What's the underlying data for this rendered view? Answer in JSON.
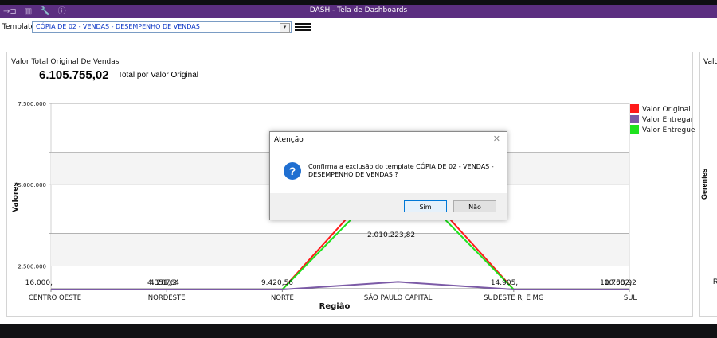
{
  "window": {
    "title": "DASH - Tela de Dashboards",
    "toolbar_icons": [
      "exit-icon",
      "grid-icon",
      "wrench-icon",
      "info-icon"
    ]
  },
  "template": {
    "label": "Template",
    "selected": "CÓPIA DE 02 - VENDAS - DESEMPENHO DE VENDAS"
  },
  "panel": {
    "title": "Valor Total Original De Vendas",
    "total_value": "6.105.755,02",
    "total_caption": "Total por Valor Original"
  },
  "panel2": {
    "title": "Valo",
    "axis_label": "Gerentes",
    "tick": "R"
  },
  "colors": {
    "titlebar": "#5b2e80",
    "valor_original": "#ff1a1a",
    "valor_entregar": "#7b5aa6",
    "valor_entregue": "#1ee21e"
  },
  "chart_data": {
    "type": "line",
    "xlabel": "Região",
    "ylabel": "Valores",
    "categories": [
      "CENTRO OESTE",
      "NORDESTE",
      "NORTE",
      "SÃO PAULO CAPITAL",
      "SUDESTE RJ E MG",
      "SUL"
    ],
    "y_ticks": [
      "2.500.000",
      "5.000.000",
      "7.500.000"
    ],
    "ylim": [
      1800000,
      7500000
    ],
    "grid": true,
    "legend_position": "top-right",
    "series": [
      {
        "name": "Valor Original",
        "values": [
          16000,
          4350,
          9100,
          5700000,
          14900,
          10700
        ]
      },
      {
        "name": "Valor Entregar",
        "values": [
          0,
          0,
          0,
          2010223.82,
          0,
          0
        ]
      },
      {
        "name": "Valor Entregue",
        "values": [
          16000,
          4300,
          9000,
          5400000,
          14800,
          10600
        ]
      }
    ],
    "data_labels": [
      {
        "text": "16.000,",
        "category": 0
      },
      {
        "text": "4.351,64",
        "category": 1
      },
      {
        "text": "4.287,2",
        "category": 1
      },
      {
        "text": "9.420,56",
        "category": 2
      },
      {
        "text": "2.010.223,82",
        "category": 3
      },
      {
        "text": "14.905,",
        "category": 4
      },
      {
        "text": "10.703,92",
        "category": 5
      },
      {
        "text": "10.582,",
        "category": 5
      }
    ]
  },
  "dialog": {
    "title": "Atenção",
    "message": "Confirma a exclusão do template CÓPIA DE 02 - VENDAS - DESEMPENHO DE VENDAS ?",
    "yes_label": "Sim",
    "no_label": "Não"
  }
}
